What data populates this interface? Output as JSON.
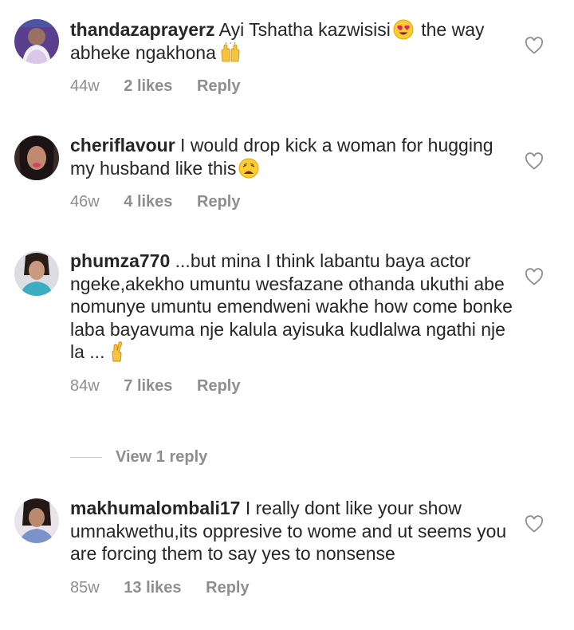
{
  "comments": [
    {
      "username": "thandazaprayerz",
      "text_parts": [
        "Ayi Tshatha kazwisisi",
        " the way abheke ngakhona"
      ],
      "emojis": [
        "heart-eyes-emoji",
        "raised-hands-emoji"
      ],
      "time": "44w",
      "likes": "2 likes",
      "reply": "Reply"
    },
    {
      "username": "cheriflavour",
      "text_parts": [
        "I would drop kick a woman for hugging my husband like this"
      ],
      "emojis": [
        "weary-face-emoji"
      ],
      "time": "46w",
      "likes": "4 likes",
      "reply": "Reply"
    },
    {
      "username": "phumza770",
      "text_parts": [
        "...but mina I think labantu baya actor ngeke,akekho umuntu wesfazane othanda ukuthi abe nomunye umuntu emendweni wakhe how come bonke laba bayavuma nje kalula ayisuka kudlalwa ngathi nje la ..."
      ],
      "emojis": [
        "crossed-fingers-emoji"
      ],
      "time": "84w",
      "likes": "7 likes",
      "reply": "Reply"
    },
    {
      "username": "makhumalombali17",
      "text_parts": [
        "I really dont like your show umnakwethu,its oppresive to wome and ut seems you are forcing them to say yes to nonsense"
      ],
      "emojis": [],
      "time": "85w",
      "likes": "13 likes",
      "reply": "Reply"
    }
  ],
  "view_replies": "View 1 reply",
  "icons": {
    "like": "heart-outline-icon"
  },
  "colors": {
    "text": "#262626",
    "muted": "#8e8e8e",
    "divider": "#c7c7c7"
  }
}
